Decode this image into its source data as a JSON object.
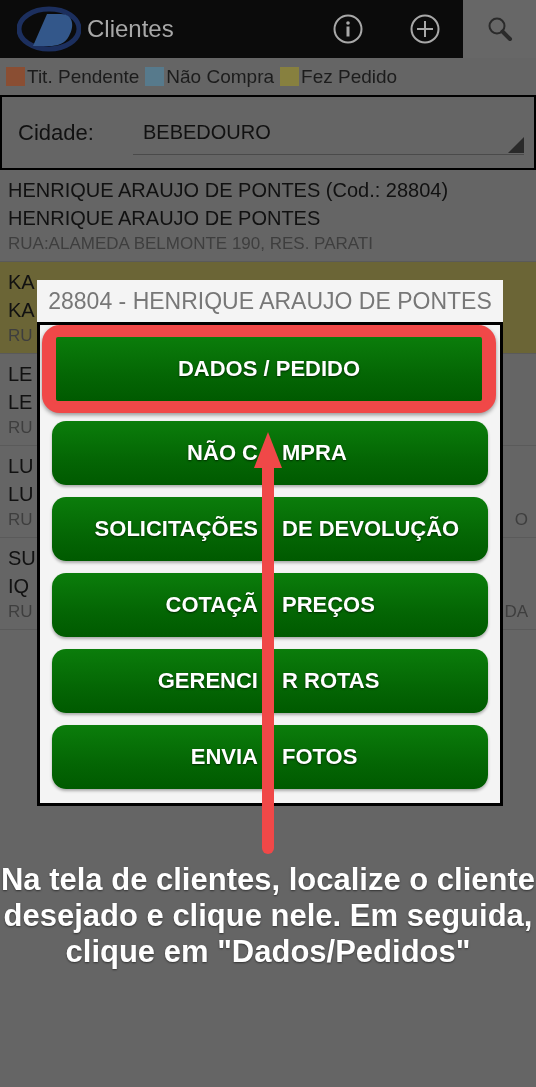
{
  "app_bar": {
    "title": "Clientes"
  },
  "legend": [
    {
      "label": "Tit. Pendente",
      "color": "#8a4e33"
    },
    {
      "label": "Não Compra",
      "color": "#577a8c"
    },
    {
      "label": "Fez Pedido",
      "color": "#87803f"
    }
  ],
  "city_filter": {
    "label": "Cidade:",
    "value": "BEBEDOURO"
  },
  "clients": [
    {
      "name": "HENRIQUE ARAUJO DE PONTES (Cod.: 28804)",
      "trade_name": "HENRIQUE ARAUJO DE PONTES",
      "address": "RUA:ALAMEDA BELMONTE 190, RES. PARATI"
    },
    {
      "name": "KA",
      "trade_name": "KA",
      "address": "RU",
      "color": "#6b6536"
    },
    {
      "name": "LE",
      "trade_name": "LE",
      "address": "RU"
    },
    {
      "name": "LU",
      "trade_name": "LU",
      "address": "RU",
      "address_tail": "O"
    },
    {
      "name": "SU",
      "trade_name": "IQ",
      "address": "RU",
      "address_tail": "DA"
    }
  ],
  "dialog": {
    "title": "28804 - HENRIQUE ARAUJO DE PONTES",
    "options": [
      {
        "label_parts": [
          "DADOS / PEDIDO"
        ],
        "highlighted": true
      },
      {
        "label_parts": [
          "NÃO C",
          "MPRA"
        ],
        "highlighted": false
      },
      {
        "label_parts": [
          "SOLICITAÇÕES",
          "DE DEVOLUÇÃO"
        ],
        "highlighted": false
      },
      {
        "label_parts": [
          "COTAÇÃ",
          "PREÇOS"
        ],
        "highlighted": false
      },
      {
        "label_parts": [
          "GERENCI",
          "R ROTAS"
        ],
        "highlighted": false
      },
      {
        "label_parts": [
          "ENVIA",
          "FOTOS"
        ],
        "highlighted": false
      }
    ]
  },
  "annotation": {
    "text": "Na tela de clientes, localize o cliente desejado e clique nele. Em seguida, clique em \"Dados/Pedidos\""
  }
}
